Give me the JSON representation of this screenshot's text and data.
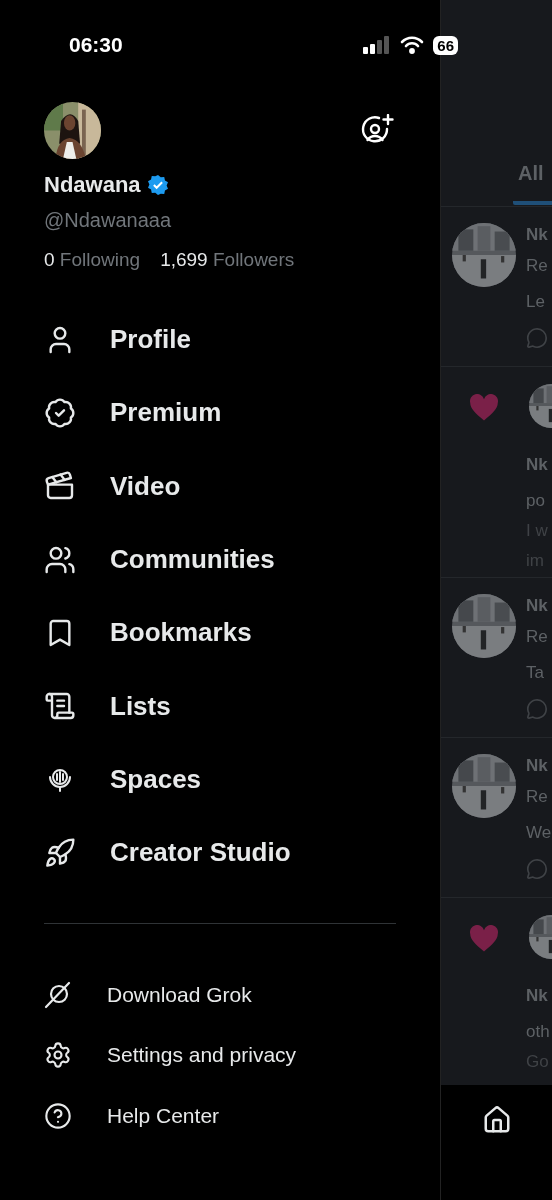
{
  "status_bar": {
    "time": "06:30",
    "battery": "66"
  },
  "profile": {
    "name": "Ndawana",
    "verified": true,
    "handle": "@Ndawanaaa",
    "following_count": "0",
    "following_label": "Following",
    "followers_count": "1,699",
    "followers_label": "Followers"
  },
  "menu": [
    {
      "kind": "profile",
      "label": "Profile"
    },
    {
      "kind": "premium",
      "label": "Premium"
    },
    {
      "kind": "video",
      "label": "Video"
    },
    {
      "kind": "communities",
      "label": "Communities"
    },
    {
      "kind": "bookmarks",
      "label": "Bookmarks"
    },
    {
      "kind": "lists",
      "label": "Lists"
    },
    {
      "kind": "spaces",
      "label": "Spaces"
    },
    {
      "kind": "creator",
      "label": "Creator Studio"
    }
  ],
  "secondary_menu": [
    {
      "kind": "grok",
      "label": "Download Grok"
    },
    {
      "kind": "settings",
      "label": "Settings and privacy"
    },
    {
      "kind": "help",
      "label": "Help Center"
    }
  ],
  "background_feed": {
    "tabs": [
      {
        "label": "All",
        "selected": true
      }
    ],
    "posts": [
      {
        "kind": "reply",
        "lines": [
          {
            "kind": "name",
            "text": "Nk"
          },
          {
            "kind": "meta",
            "text": "Re"
          },
          {
            "kind": "body",
            "text": "Le"
          }
        ]
      },
      {
        "kind": "like",
        "lines": [
          {
            "kind": "name",
            "text": "Nk"
          },
          {
            "kind": "body",
            "text": "po"
          },
          {
            "kind": "faint",
            "text": "I w"
          },
          {
            "kind": "faint",
            "text": "im"
          }
        ]
      },
      {
        "kind": "reply",
        "lines": [
          {
            "kind": "name",
            "text": "Nk"
          },
          {
            "kind": "meta",
            "text": "Re"
          },
          {
            "kind": "body",
            "text": "Ta"
          }
        ]
      },
      {
        "kind": "reply",
        "lines": [
          {
            "kind": "name",
            "text": "Nk"
          },
          {
            "kind": "meta",
            "text": "Re"
          },
          {
            "kind": "body",
            "text": "We"
          }
        ]
      },
      {
        "kind": "like",
        "lines": [
          {
            "kind": "name",
            "text": "Nk"
          },
          {
            "kind": "body",
            "text": "oth"
          },
          {
            "kind": "faint",
            "text": "Go"
          }
        ]
      }
    ]
  }
}
